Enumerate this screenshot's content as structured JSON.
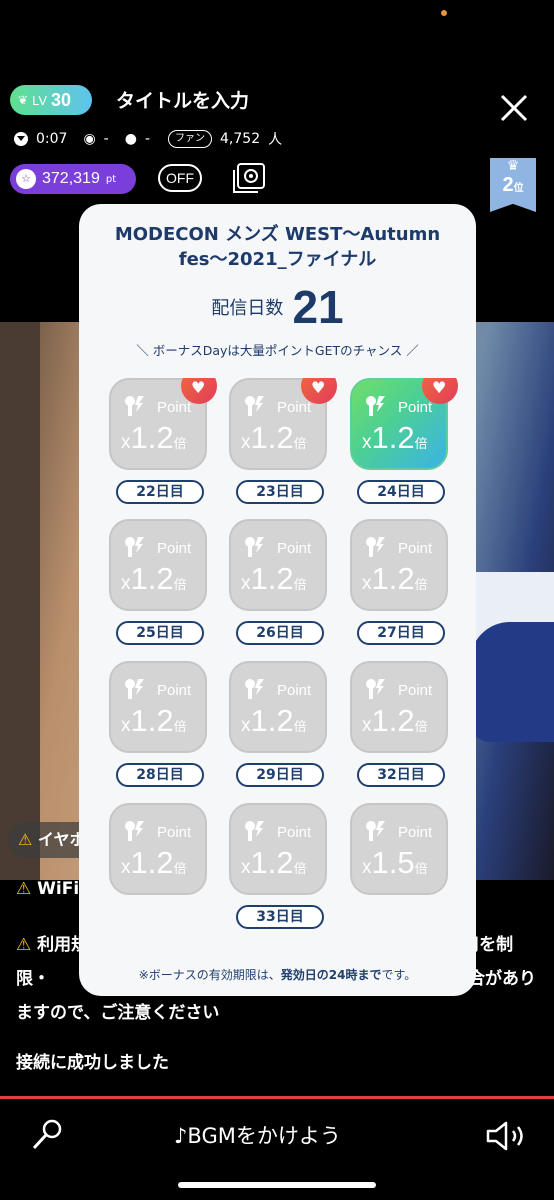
{
  "header": {
    "level_label": "LV",
    "level": "30",
    "title": "タイトルを入力",
    "duration": "0:07",
    "viewers": "-",
    "comments": "-",
    "fan_label": "ファン",
    "fan_count": "4,752",
    "fan_unit": "人",
    "points": "372,319",
    "points_unit": "pt",
    "off_label": "OFF",
    "rank": "2",
    "rank_unit": "位"
  },
  "modal": {
    "title": "MODECON メンズ WEST〜Autumn fes〜2021_ファイナル",
    "days_label": "配信日数",
    "days_value": "21",
    "bonus_note": "＼ ボーナスDayは大量ポイントGETのチャンス ／",
    "point_label": "Point",
    "mult_prefix": "x",
    "mult_suffix": "倍",
    "cards": [
      {
        "multiplier": "1.2",
        "day": "22日目",
        "active": false,
        "heart": true
      },
      {
        "multiplier": "1.2",
        "day": "23日目",
        "active": false,
        "heart": true
      },
      {
        "multiplier": "1.2",
        "day": "24日目",
        "active": true,
        "heart": true
      },
      {
        "multiplier": "1.2",
        "day": "25日目",
        "active": false,
        "heart": false
      },
      {
        "multiplier": "1.2",
        "day": "26日目",
        "active": false,
        "heart": false
      },
      {
        "multiplier": "1.2",
        "day": "27日目",
        "active": false,
        "heart": false
      },
      {
        "multiplier": "1.2",
        "day": "28日目",
        "active": false,
        "heart": false
      },
      {
        "multiplier": "1.2",
        "day": "29日目",
        "active": false,
        "heart": false
      },
      {
        "multiplier": "1.2",
        "day": "32日目",
        "active": false,
        "heart": false
      },
      {
        "multiplier": "1.2",
        "day": "",
        "active": false,
        "heart": false
      },
      {
        "multiplier": "1.2",
        "day": "33日目",
        "active": false,
        "heart": false
      },
      {
        "multiplier": "1.5",
        "day": "",
        "active": false,
        "heart": false
      }
    ],
    "footer_pre": "※ボーナスの有効期限は、",
    "footer_bold": "発効日の24時まで",
    "footer_post": "です。"
  },
  "messages": {
    "dim_msg": "イヤホ",
    "wifi_msg": "WiFi接続",
    "terms_msg": "利用規約に違反する行為があった場合、アカウントの利用を制限・",
    "terms_tail": "ますので、ご注意ください",
    "terms_right": "場合があり",
    "connected": "接続に成功しました"
  },
  "bottom": {
    "bgm_label": "BGMをかけよう"
  },
  "colors": {
    "level_badge": "#5ee08e",
    "points_badge": "#7b3fd9",
    "rank_flag": "#8fb6e3",
    "active_card": "#4ccf96",
    "divider": "#e0403c"
  }
}
